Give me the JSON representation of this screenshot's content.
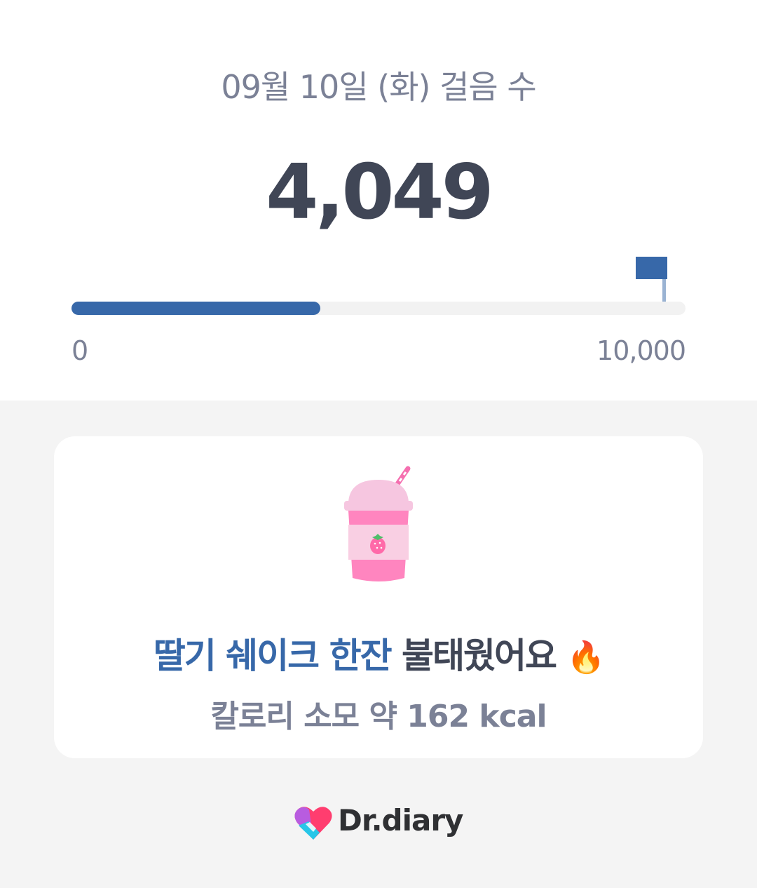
{
  "header": {
    "date_title": "09월 10일 (화) 걸음 수",
    "steps": "4,049"
  },
  "progress": {
    "current": 4049,
    "goal": 10000,
    "fraction": 0.4049,
    "min_label": "0",
    "max_label": "10,000",
    "goal_icon": "goal-flag-icon"
  },
  "card": {
    "illustration": "strawberry-shake-icon",
    "headline_accent": "딸기 쉐이크 한잔",
    "headline_rest": "불태웠어요",
    "headline_emoji": "🔥",
    "calories": "칼로리 소모 약 162 kcal"
  },
  "footer": {
    "brand": "Dr.diary",
    "brand_icon": "dr-diary-logo-icon"
  },
  "colors": {
    "accent": "#3768a9",
    "text_dark": "#404656",
    "text_muted": "#7b8196",
    "background": "#f4f4f4"
  }
}
